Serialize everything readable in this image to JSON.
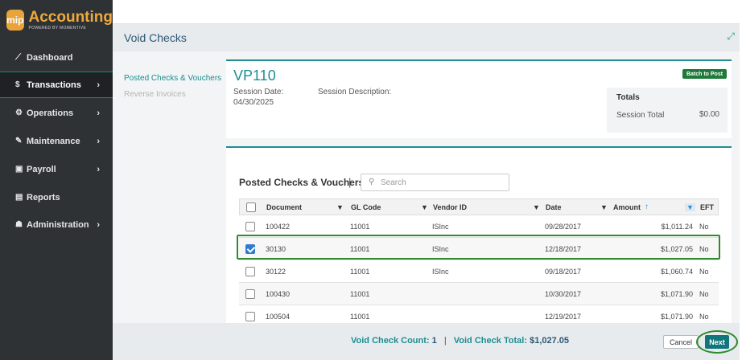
{
  "app": {
    "logo_mark": "mip",
    "title": "Accounting",
    "subtitle": "POWERED BY MOMENTIVE"
  },
  "sidebar": {
    "items": [
      {
        "label": "Dashboard",
        "icon": "chart-line-icon",
        "glyph": "⟋",
        "chevron": ""
      },
      {
        "label": "Transactions",
        "icon": "dollar-icon",
        "glyph": "$",
        "chevron": "›"
      },
      {
        "label": "Operations",
        "icon": "gears-icon",
        "glyph": "⚙",
        "chevron": "›"
      },
      {
        "label": "Maintenance",
        "icon": "wrench-icon",
        "glyph": "✎",
        "chevron": "›"
      },
      {
        "label": "Payroll",
        "icon": "money-icon",
        "glyph": "▣",
        "chevron": "›"
      },
      {
        "label": "Reports",
        "icon": "file-icon",
        "glyph": "▤",
        "chevron": ""
      },
      {
        "label": "Administration",
        "icon": "users-icon",
        "glyph": "☗",
        "chevron": "›"
      }
    ],
    "active_index": 1
  },
  "header": {
    "title": "Void Checks",
    "expand_glyph": "⤢"
  },
  "subnav": {
    "items": [
      {
        "label": "Posted Checks & Vouchers",
        "state": "active"
      },
      {
        "label": "Reverse Invoices",
        "state": "disabled"
      }
    ]
  },
  "session": {
    "id": "VP110",
    "date_label": "Session Date:",
    "date_value": "04/30/2025",
    "description_label": "Session Description:",
    "batch_button": "Batch to Post",
    "totals_title": "Totals",
    "totals_label": "Session Total",
    "totals_value": "$0.00"
  },
  "grid": {
    "title": "Posted Checks & Vouchers",
    "separator": "|",
    "search_placeholder": "Search",
    "columns": {
      "document": "Document",
      "gl_code": "GL Code",
      "vendor_id": "Vendor ID",
      "date": "Date",
      "amount": "Amount",
      "eft": "EFT"
    },
    "rows": [
      {
        "document": "100422",
        "gl_code": "11001",
        "vendor_id": "ISInc",
        "date": "09/28/2017",
        "amount": "$1,011.24",
        "eft": "No",
        "checked": false
      },
      {
        "document": "30130",
        "gl_code": "11001",
        "vendor_id": "ISInc",
        "date": "12/18/2017",
        "amount": "$1,027.05",
        "eft": "No",
        "checked": true
      },
      {
        "document": "30122",
        "gl_code": "11001",
        "vendor_id": "ISInc",
        "date": "09/18/2017",
        "amount": "$1,060.74",
        "eft": "No",
        "checked": false
      },
      {
        "document": "100430",
        "gl_code": "11001",
        "vendor_id": "",
        "date": "10/30/2017",
        "amount": "$1,071.90",
        "eft": "No",
        "checked": false
      },
      {
        "document": "100504",
        "gl_code": "11001",
        "vendor_id": "",
        "date": "12/19/2017",
        "amount": "$1,071.90",
        "eft": "No",
        "checked": false
      }
    ]
  },
  "footer": {
    "count_label": "Void Check Count:",
    "count_value": "1",
    "separator": "|",
    "total_label": "Void Check Total:",
    "total_value": "$1,027.05",
    "cancel_label": "Cancel",
    "next_label": "Next"
  },
  "colors": {
    "accent": "#1e8e92",
    "sidebar": "#2f3235",
    "logo": "#f0a93b",
    "highlight": "#2f8a2f",
    "checkbox": "#2d7cd0"
  }
}
